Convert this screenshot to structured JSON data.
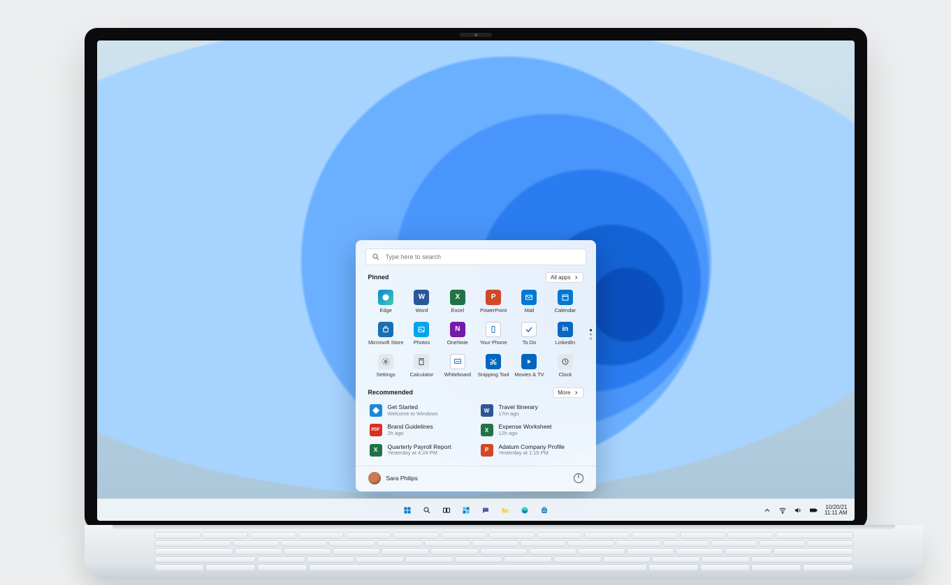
{
  "search": {
    "placeholder": "Type here to search"
  },
  "pinned": {
    "title": "Pinned",
    "all_apps_label": "All apps",
    "apps": [
      {
        "label": "Edge",
        "name": "edge"
      },
      {
        "label": "Word",
        "name": "word"
      },
      {
        "label": "Excel",
        "name": "excel"
      },
      {
        "label": "PowerPoint",
        "name": "powerpoint"
      },
      {
        "label": "Mail",
        "name": "mail"
      },
      {
        "label": "Calendar",
        "name": "calendar"
      },
      {
        "label": "Microsoft Store",
        "name": "store"
      },
      {
        "label": "Photos",
        "name": "photos"
      },
      {
        "label": "OneNote",
        "name": "onenote"
      },
      {
        "label": "Your Phone",
        "name": "your-phone"
      },
      {
        "label": "To Do",
        "name": "todo"
      },
      {
        "label": "LinkedIn",
        "name": "linkedin"
      },
      {
        "label": "Settings",
        "name": "settings"
      },
      {
        "label": "Calculator",
        "name": "calculator"
      },
      {
        "label": "Whiteboard",
        "name": "whiteboard"
      },
      {
        "label": "Snipping Tool",
        "name": "snipping-tool"
      },
      {
        "label": "Movies & TV",
        "name": "movies-tv"
      },
      {
        "label": "Clock",
        "name": "clock"
      }
    ]
  },
  "recommended": {
    "title": "Recommended",
    "more_label": "More",
    "items": [
      {
        "title": "Get Started",
        "subtitle": "Welcome to Windows"
      },
      {
        "title": "Travel Itinerary",
        "subtitle": "17m ago"
      },
      {
        "title": "Brand Guidelines",
        "subtitle": "2h ago"
      },
      {
        "title": "Expense Worksheet",
        "subtitle": "12h ago"
      },
      {
        "title": "Quarterly Payroll Report",
        "subtitle": "Yesterday at 4:24 PM"
      },
      {
        "title": "Adatum Company Profile",
        "subtitle": "Yesterday at 1:15 PM"
      }
    ]
  },
  "user": {
    "name": "Sara Philips"
  },
  "taskbar": {
    "items": [
      "start",
      "search",
      "task-view",
      "widgets",
      "chat",
      "file-explorer",
      "edge",
      "store"
    ]
  },
  "tray": {
    "date": "10/20/21",
    "time": "11:11 AM"
  }
}
